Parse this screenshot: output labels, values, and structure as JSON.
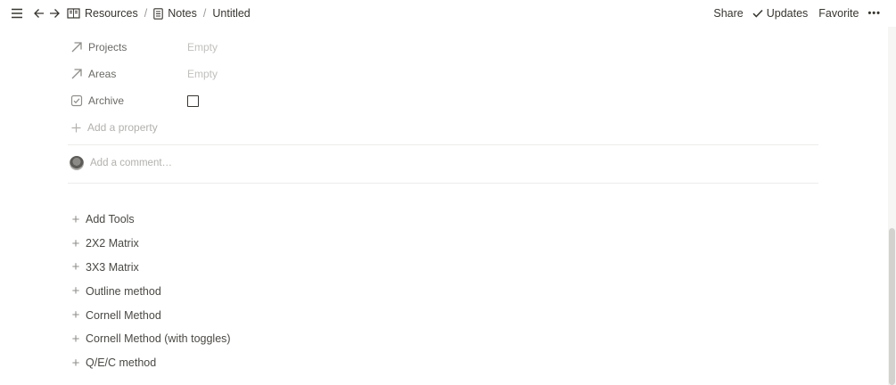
{
  "topbar": {
    "breadcrumb": [
      {
        "label": "Resources",
        "icon": "book-icon"
      },
      {
        "label": "Notes",
        "icon": "page-icon"
      },
      {
        "label": "Untitled"
      }
    ],
    "separator": "/",
    "actions": {
      "share": "Share",
      "updates": "Updates",
      "favorite": "Favorite",
      "more": "•••"
    }
  },
  "properties": [
    {
      "name": "Projects",
      "icon": "relation-arrow-icon",
      "value": "Empty"
    },
    {
      "name": "Areas",
      "icon": "relation-arrow-icon",
      "value": "Empty"
    },
    {
      "name": "Archive",
      "icon": "checkbox-property-icon",
      "type": "checkbox",
      "checked": false
    }
  ],
  "add_property": "Add a property",
  "comment_placeholder": "Add a comment…",
  "tools": [
    "Add Tools",
    "2X2 Matrix",
    "3X3 Matrix",
    "Outline method",
    "Cornell Method",
    "Cornell Method (with toggles)",
    "Q/E/C method"
  ],
  "plus_glyph": "+"
}
